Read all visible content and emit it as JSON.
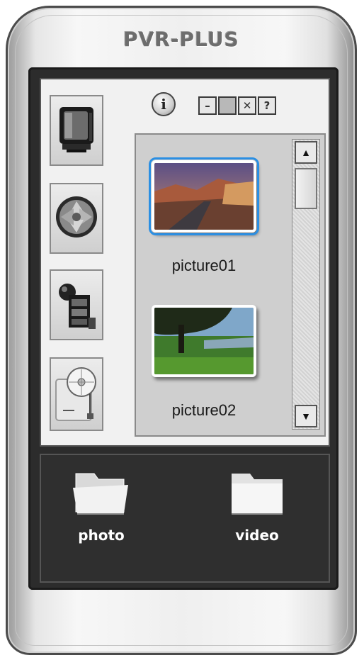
{
  "app": {
    "title": "PVR-PLUS"
  },
  "controls": {
    "info_label": "i",
    "minimize_label": "–",
    "maximize_label": "",
    "close_label": "✕",
    "help_label": "?"
  },
  "modes": [
    {
      "icon": "tv-icon"
    },
    {
      "icon": "capture-shutter-icon"
    },
    {
      "icon": "video-film-icon"
    },
    {
      "icon": "disc-device-icon"
    }
  ],
  "thumbnails": [
    {
      "caption": "picture01",
      "selected": true,
      "icon": "landscape-road-image"
    },
    {
      "caption": "picture02",
      "selected": false,
      "icon": "tree-meadow-image"
    }
  ],
  "scrollbar": {
    "up_glyph": "▲",
    "down_glyph": "▼"
  },
  "folders": [
    {
      "label": "photo",
      "icon": "folder-open-icon"
    },
    {
      "label": "video",
      "icon": "folder-icon"
    }
  ],
  "colors": {
    "selection": "#2b8fe3",
    "bezel": "#2c2c2c",
    "brand_text": "#6d6d6d"
  }
}
